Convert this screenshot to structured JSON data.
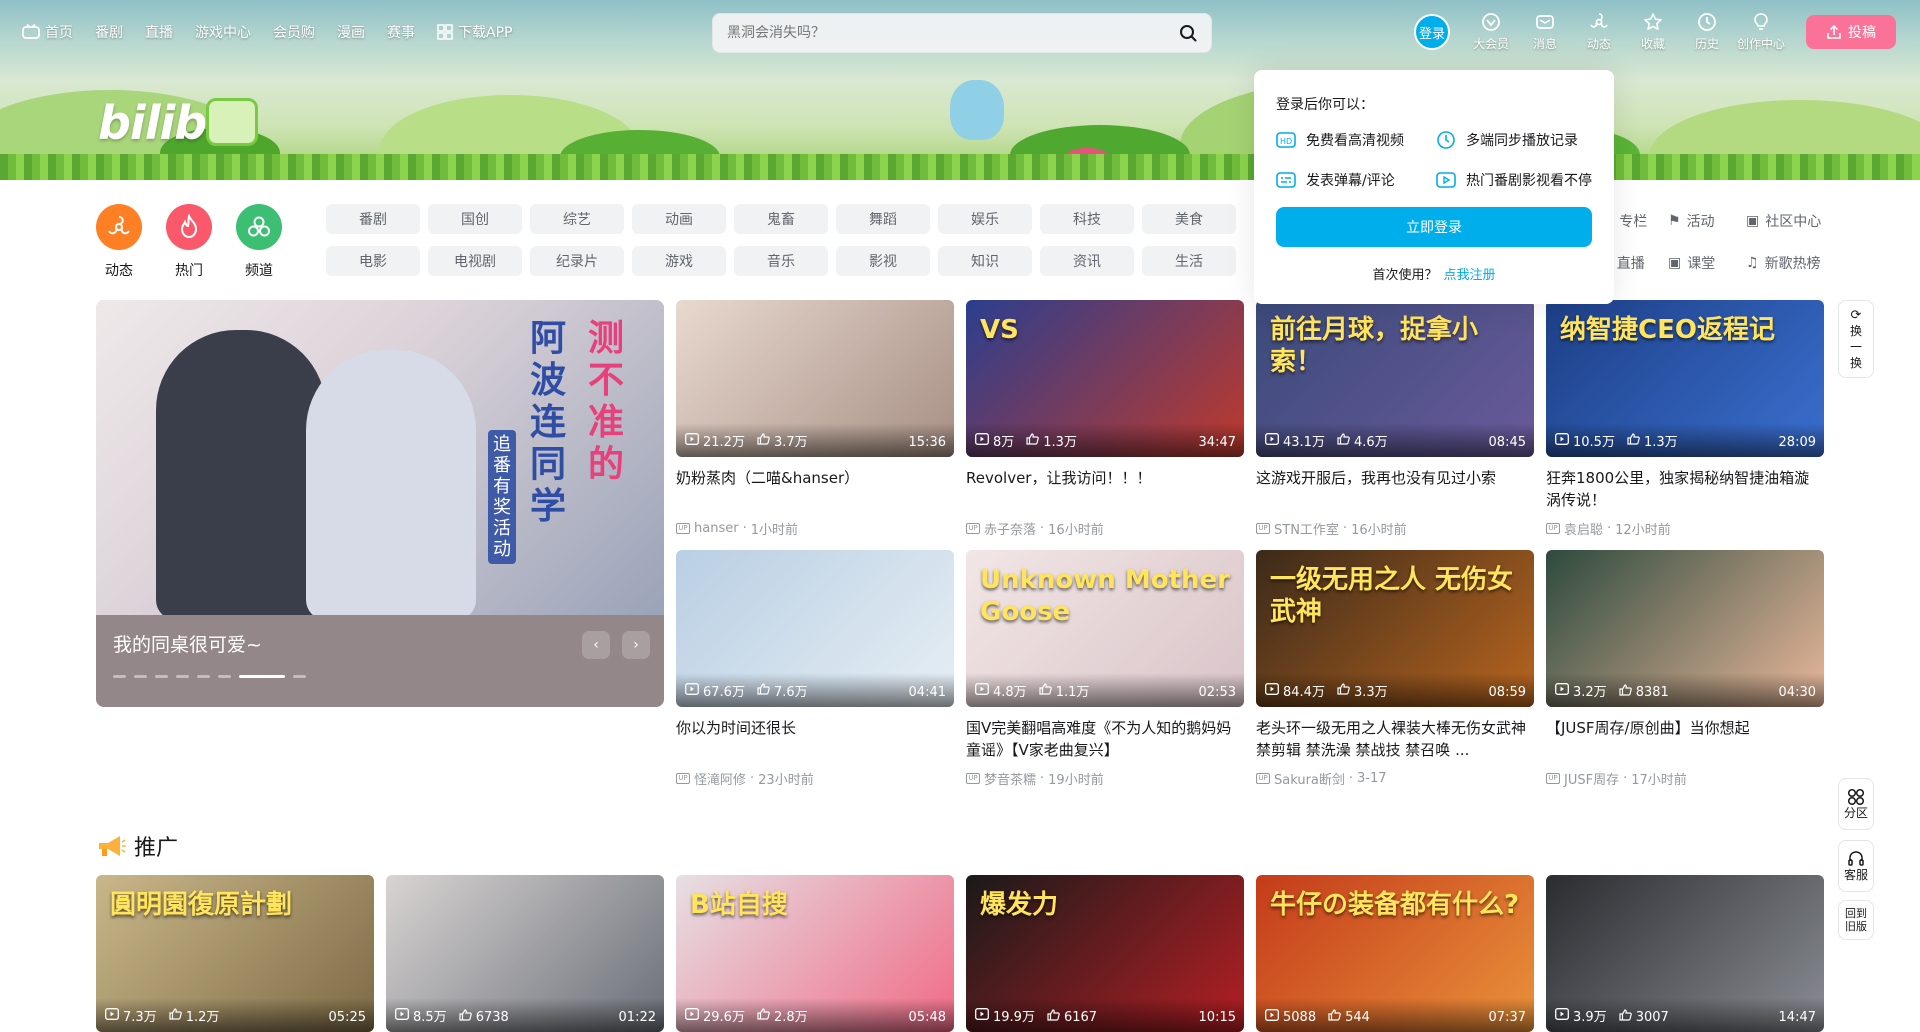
{
  "nav": {
    "left": [
      {
        "label": "首页",
        "icon": "tv-icon"
      },
      {
        "label": "番剧"
      },
      {
        "label": "直播"
      },
      {
        "label": "游戏中心"
      },
      {
        "label": "会员购"
      },
      {
        "label": "漫画"
      },
      {
        "label": "赛事"
      },
      {
        "label": "下载APP",
        "icon": "app-grid-icon"
      }
    ],
    "search_placeholder": "黑洞会消失吗？",
    "login_avatar": "登录",
    "right": [
      {
        "label": "大会员",
        "icon": "vip-icon"
      },
      {
        "label": "消息",
        "icon": "message-icon"
      },
      {
        "label": "动态",
        "icon": "dynamic-icon"
      },
      {
        "label": "收藏",
        "icon": "star-icon"
      },
      {
        "label": "历史",
        "icon": "clock-icon"
      },
      {
        "label": "创作中心",
        "icon": "bulb-icon"
      }
    ],
    "upload_label": "投稿"
  },
  "logo_text": "bilibili",
  "big_channels": [
    {
      "label": "动态",
      "color": "#ff7f24"
    },
    {
      "label": "热门",
      "color": "#f9596a"
    },
    {
      "label": "频道",
      "color": "#3dbf73"
    }
  ],
  "chips_row1": [
    "番剧",
    "国创",
    "综艺",
    "动画",
    "鬼畜",
    "舞蹈",
    "娱乐",
    "科技",
    "美食"
  ],
  "chips_row2": [
    "电影",
    "电视剧",
    "纪录片",
    "游戏",
    "音乐",
    "影视",
    "知识",
    "资讯",
    "生活"
  ],
  "right_links_row1": [
    "专栏",
    "活动",
    "社区中心"
  ],
  "right_links_row2": [
    "直播",
    "课堂",
    "新歌热榜"
  ],
  "carousel": {
    "title": "我的同桌很可爱~",
    "art_text_1": "测不准的",
    "art_text_2": "阿波连同学",
    "art_text_3": "追番有奖活动",
    "prev": "‹",
    "next": "›"
  },
  "refresh_label": "换一换",
  "cards": [
    {
      "title": "奶粉蒸肉（二喵&hanser）",
      "views": "21.2万",
      "likes": "3.7万",
      "duration": "15:36",
      "author": "hanser",
      "time": "1小时前",
      "colors": [
        "#e8d9cf",
        "#a78f84"
      ]
    },
    {
      "title": "Revolver，让我访问！！！",
      "views": "8万",
      "likes": "1.3万",
      "duration": "34:47",
      "author": "赤子奈落",
      "time": "16小时前",
      "colors": [
        "#2b3e8f",
        "#c0392b"
      ],
      "art": "VS"
    },
    {
      "title": "这游戏开服后，我再也没有见过小索",
      "views": "43.1万",
      "likes": "4.6万",
      "duration": "08:45",
      "author": "STN工作室",
      "time": "16小时前",
      "colors": [
        "#3a4a7a",
        "#6a5a9a"
      ],
      "art": "前往月球，捉拿小索！"
    },
    {
      "title": "狂奔1800公里，独家揭秘纳智捷油箱漩涡传说！",
      "views": "10.5万",
      "likes": "1.3万",
      "duration": "28:09",
      "author": "袁启聪",
      "time": "12小时前",
      "colors": [
        "#1d3f86",
        "#3a6fcf"
      ],
      "art": "纳智捷CEO返程记"
    },
    {
      "title": "你以为时间还很长",
      "views": "67.6万",
      "likes": "7.6万",
      "duration": "04:41",
      "author": "怪滝阿修",
      "time": "23小时前",
      "colors": [
        "#b9cfe3",
        "#e6eef4"
      ]
    },
    {
      "title": "国V完美翻唱高难度《不为人知的鹅妈妈童谣》【V家老曲复兴】",
      "views": "4.8万",
      "likes": "1.1万",
      "duration": "02:53",
      "author": "梦音茶糯",
      "time": "19小时前",
      "colors": [
        "#f2e6e6",
        "#d9c4c8"
      ],
      "art": "Unknown Mother Goose"
    },
    {
      "title": "老头环一级无用之人裸装大棒无伤女武神 禁剪辑 禁洗澡 禁战技 禁召唤 ...",
      "views": "84.4万",
      "likes": "3.3万",
      "duration": "08:59",
      "author": "Sakura断剑",
      "time": "3-17",
      "colors": [
        "#3b2a1a",
        "#b8651f"
      ],
      "art": "一级无用之人 无伤女武神"
    },
    {
      "title": "【JUSF周存/原创曲】当你想起",
      "views": "3.2万",
      "likes": "8381",
      "duration": "04:30",
      "author": "JUSF周存",
      "time": "17小时前",
      "colors": [
        "#2d4a3e",
        "#e9b89a"
      ]
    }
  ],
  "login_popup": {
    "header": "登录后你可以：",
    "features": [
      "免费看高清视频",
      "多端同步播放记录",
      "发表弹幕/评论",
      "热门番剧影视看不停"
    ],
    "button": "立即登录",
    "first_use": "首次使用？",
    "register": "点我注册"
  },
  "side_tools": {
    "zone": "分区",
    "service": "客服",
    "old": "回到旧版"
  },
  "promo": {
    "title": "推广",
    "cards": [
      {
        "views": "7.3万",
        "likes": "1.2万",
        "duration": "05:25",
        "art": "圓明園復原計劃",
        "colors": [
          "#c9b78a",
          "#7d6a45"
        ]
      },
      {
        "views": "8.5万",
        "likes": "6738",
        "duration": "01:22",
        "colors": [
          "#d8d4d2",
          "#6a6e78"
        ]
      },
      {
        "views": "29.6万",
        "likes": "2.8万",
        "duration": "05:48",
        "art": "B站自搜",
        "colors": [
          "#e6e0e4",
          "#f06a86"
        ]
      },
      {
        "views": "19.9万",
        "likes": "6167",
        "duration": "10:15",
        "art": "爆发力",
        "colors": [
          "#1a1a1a",
          "#b51f24"
        ]
      },
      {
        "views": "5088",
        "likes": "544",
        "duration": "07:37",
        "art": "牛仔の装备都有什么?",
        "colors": [
          "#c43b1a",
          "#e9923a"
        ]
      },
      {
        "views": "3.9万",
        "likes": "3007",
        "duration": "14:47",
        "colors": [
          "#2a2c30",
          "#8a8d93"
        ]
      }
    ]
  }
}
